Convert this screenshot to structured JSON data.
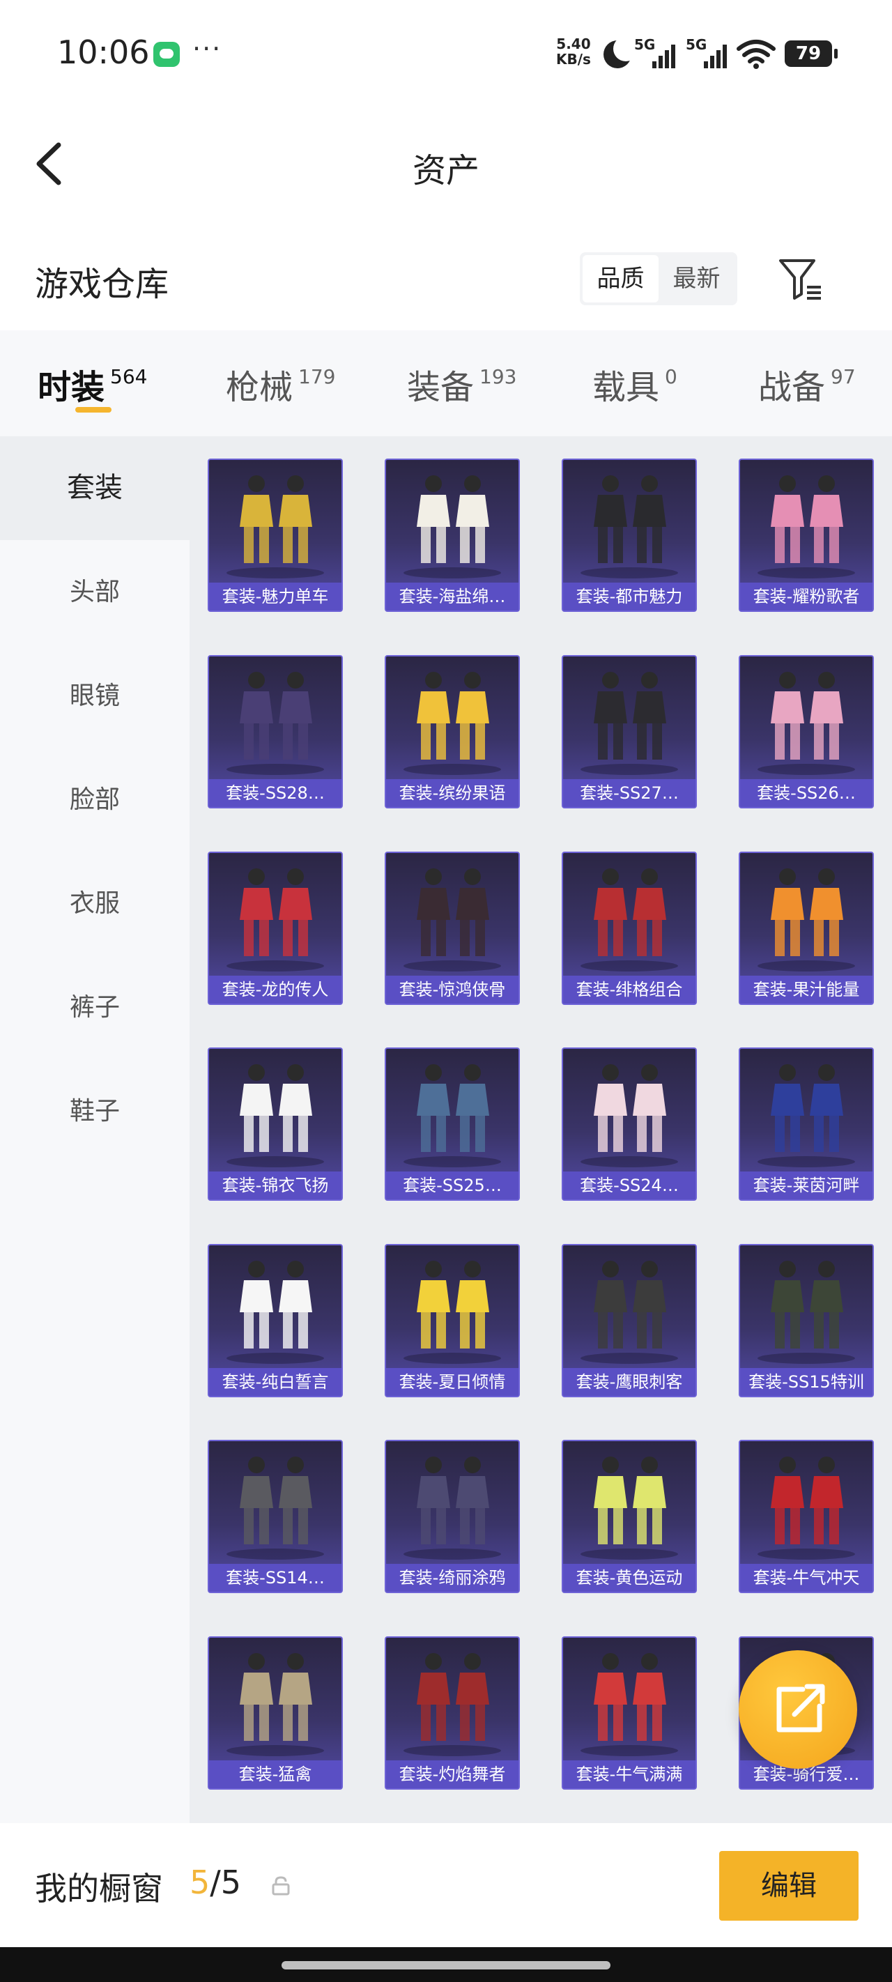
{
  "status_bar": {
    "time": "10:06",
    "speed_value": "5.40",
    "speed_unit": "KB/s",
    "sig1_label": "5G",
    "sig2_label": "5G",
    "battery": "79"
  },
  "header": {
    "title": "资产"
  },
  "section": {
    "title": "游戏仓库",
    "sort_options": [
      "品质",
      "最新"
    ]
  },
  "tabs": [
    {
      "label": "时装",
      "count": "564"
    },
    {
      "label": "枪械",
      "count": "179"
    },
    {
      "label": "装备",
      "count": "193"
    },
    {
      "label": "载具",
      "count": "0"
    },
    {
      "label": "战备",
      "count": "97"
    }
  ],
  "sidebar": [
    "套装",
    "头部",
    "眼镜",
    "脸部",
    "衣服",
    "裤子",
    "鞋子"
  ],
  "items": [
    "套装-魅力单车",
    "套装-海盐绵…",
    "套装-都市魅力",
    "套装-耀粉歌者",
    "套装-SS28…",
    "套装-缤纷果语",
    "套装-SS27…",
    "套装-SS26…",
    "套装-龙的传人",
    "套装-惊鸿侠骨",
    "套装-绯格组合",
    "套装-果汁能量",
    "套装-锦衣飞扬",
    "套装-SS25…",
    "套装-SS24…",
    "套装-莱茵河畔",
    "套装-纯白誓言",
    "套装-夏日倾情",
    "套装-鹰眼刺客",
    "套装-SS15特训",
    "套装-SS14…",
    "套装-绮丽涂鸦",
    "套装-黄色运动",
    "套装-牛气冲天",
    "套装-猛禽",
    "套装-灼焰舞者",
    "套装-牛气满满",
    "套装-骑行爱…"
  ],
  "outfit_colors": [
    "#d9b43a",
    "#f2efe6",
    "#2a2a2e",
    "#e58fb4",
    "#4a3f75",
    "#f0c23a",
    "#2c2b30",
    "#e8a6c2",
    "#c8323c",
    "#3a2b33",
    "#b82f32",
    "#f0902e",
    "#f4f4f4",
    "#4e6f98",
    "#f0d8e0",
    "#2e3f9c",
    "#f6f6f6",
    "#f2d13a",
    "#3c3c3c",
    "#3d4637",
    "#5a5a60",
    "#4d4a72",
    "#dfe66e",
    "#c2262c",
    "#b5a584",
    "#9e2c2c",
    "#d23a3a",
    "#5a5a5a"
  ],
  "showcase": {
    "label": "我的橱窗",
    "current": "5",
    "separator": "/",
    "total": "5",
    "edit_label": "编辑"
  }
}
